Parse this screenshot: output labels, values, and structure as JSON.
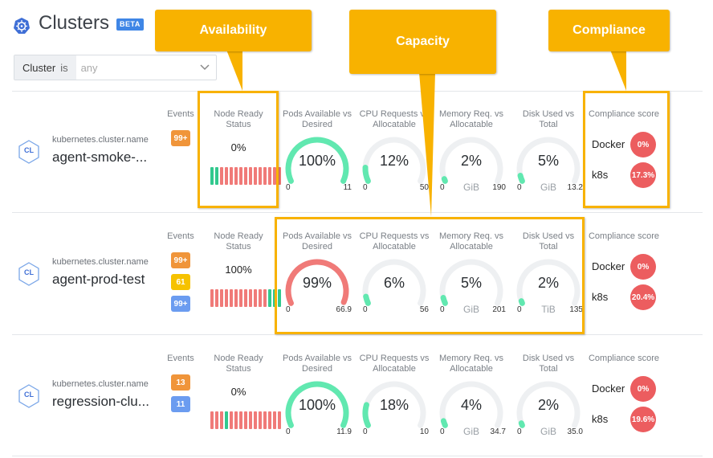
{
  "header": {
    "title": "Clusters",
    "beta_label": "BETA",
    "icon": "kubernetes-wheel-icon"
  },
  "filter": {
    "key": "Cluster",
    "operator": "is",
    "placeholder": "any"
  },
  "columns": {
    "events": "Events",
    "node_ready": "Node Ready Status",
    "pods": "Pods Available vs Desired",
    "cpu": "CPU Requests vs Allocatable",
    "memory": "Memory Req. vs Allocatable",
    "disk": "Disk Used vs Total",
    "compliance": "Compliance score"
  },
  "clusters": [
    {
      "icon_label": "CL",
      "name_label": "kubernetes.cluster.name",
      "name": "agent-smoke-...",
      "events": [
        {
          "value": "99+",
          "color": "#f0953a"
        }
      ],
      "node_ready_pct": "0%",
      "node_bars": [
        "g",
        "g",
        "r",
        "r",
        "r",
        "r",
        "r",
        "r",
        "r",
        "r",
        "r",
        "r",
        "r",
        "r",
        "r"
      ],
      "gauges": [
        {
          "value": "100%",
          "fraction": 1.0,
          "color": "#61e8b0",
          "min": "0",
          "max": "11",
          "unit": ""
        },
        {
          "value": "12%",
          "fraction": 0.12,
          "color": "#61e8b0",
          "min": "0",
          "max": "50",
          "unit": ""
        },
        {
          "value": "2%",
          "fraction": 0.02,
          "color": "#61e8b0",
          "min": "0",
          "max": "190",
          "unit": "GiB"
        },
        {
          "value": "5%",
          "fraction": 0.05,
          "color": "#61e8b0",
          "min": "0",
          "max": "13.2",
          "unit": "GiB"
        }
      ],
      "compliance": [
        {
          "label": "Docker",
          "score": "0%"
        },
        {
          "label": "k8s",
          "score": "17.3%"
        }
      ]
    },
    {
      "icon_label": "CL",
      "name_label": "kubernetes.cluster.name",
      "name": "agent-prod-test",
      "events": [
        {
          "value": "99+",
          "color": "#f0953a"
        },
        {
          "value": "61",
          "color": "#f6c200"
        },
        {
          "value": "99+",
          "color": "#6b9cf0"
        }
      ],
      "node_ready_pct": "100%",
      "node_bars": [
        "r",
        "r",
        "r",
        "r",
        "r",
        "r",
        "r",
        "r",
        "r",
        "r",
        "r",
        "r",
        "g",
        "g",
        "g"
      ],
      "gauges": [
        {
          "value": "99%",
          "fraction": 0.99,
          "color": "#f07a78",
          "min": "0",
          "max": "66.9",
          "unit": ""
        },
        {
          "value": "6%",
          "fraction": 0.06,
          "color": "#61e8b0",
          "min": "0",
          "max": "56",
          "unit": ""
        },
        {
          "value": "5%",
          "fraction": 0.05,
          "color": "#61e8b0",
          "min": "0",
          "max": "201",
          "unit": "GiB"
        },
        {
          "value": "2%",
          "fraction": 0.02,
          "color": "#61e8b0",
          "min": "0",
          "max": "135",
          "unit": "TiB"
        }
      ],
      "compliance": [
        {
          "label": "Docker",
          "score": "0%"
        },
        {
          "label": "k8s",
          "score": "20.4%"
        }
      ]
    },
    {
      "icon_label": "CL",
      "name_label": "kubernetes.cluster.name",
      "name": "regression-clu...",
      "events": [
        {
          "value": "13",
          "color": "#f0953a"
        },
        {
          "value": "11",
          "color": "#6b9cf0"
        }
      ],
      "node_ready_pct": "0%",
      "node_bars": [
        "r",
        "r",
        "r",
        "g",
        "r",
        "r",
        "r",
        "r",
        "r",
        "r",
        "r",
        "r",
        "r",
        "r",
        "r"
      ],
      "gauges": [
        {
          "value": "100%",
          "fraction": 1.0,
          "color": "#61e8b0",
          "min": "0",
          "max": "11.9",
          "unit": ""
        },
        {
          "value": "18%",
          "fraction": 0.18,
          "color": "#61e8b0",
          "min": "0",
          "max": "10",
          "unit": ""
        },
        {
          "value": "4%",
          "fraction": 0.04,
          "color": "#61e8b0",
          "min": "0",
          "max": "34.7",
          "unit": "GiB"
        },
        {
          "value": "2%",
          "fraction": 0.02,
          "color": "#61e8b0",
          "min": "0",
          "max": "35.0",
          "unit": "GiB"
        }
      ],
      "compliance": [
        {
          "label": "Docker",
          "score": "0%"
        },
        {
          "label": "k8s",
          "score": "19.6%"
        }
      ]
    }
  ],
  "annotations": {
    "availability": "Availability",
    "capacity": "Capacity",
    "compliance": "Compliance"
  },
  "colors": {
    "accent": "#3f86e6",
    "callout": "#f8b200",
    "green": "#32c98e",
    "red": "#f07a78"
  }
}
